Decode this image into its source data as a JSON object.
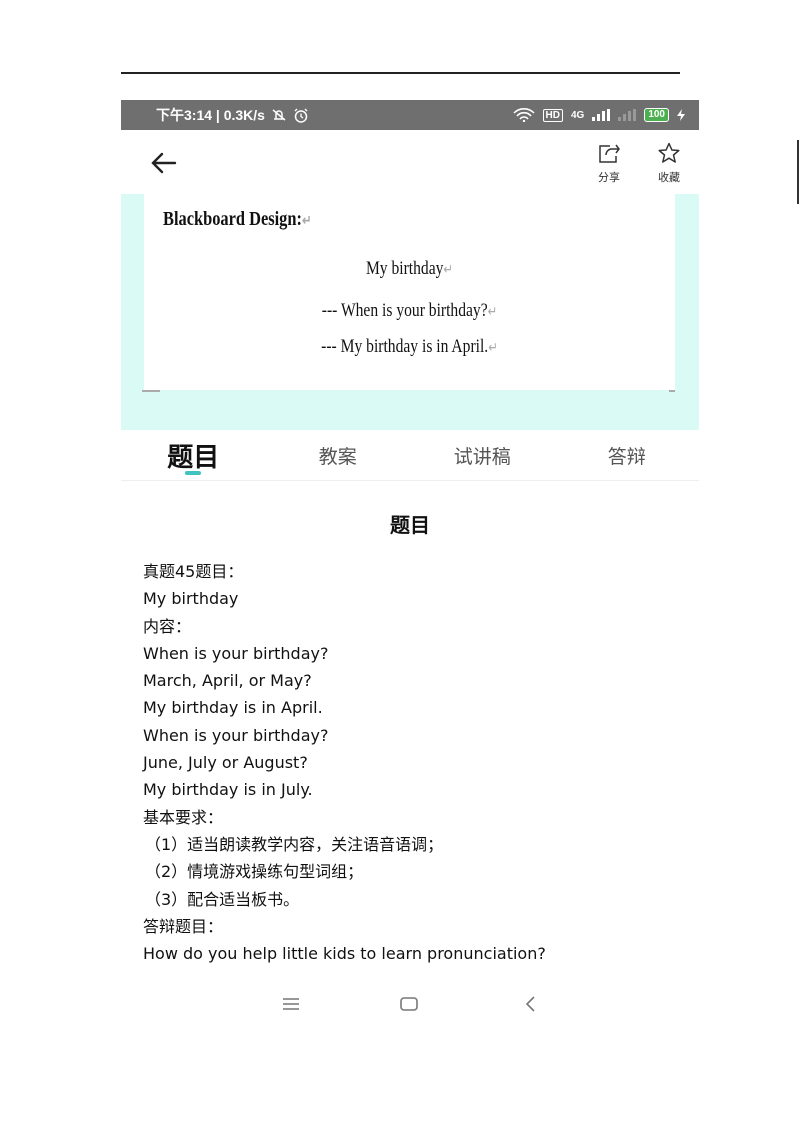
{
  "statusbar": {
    "time_network": "下午3:14 | 0.3K/s",
    "signal_4g": "4G",
    "hd": "HD",
    "battery": "100"
  },
  "appbar": {
    "share_label": "分享",
    "favorite_label": "收藏"
  },
  "blackboard": {
    "title": "Blackboard Design:",
    "lines": [
      "My birthday",
      "--- When is your birthday?",
      "--- My birthday is in April."
    ]
  },
  "tabs": [
    {
      "label": "题目",
      "active": true
    },
    {
      "label": "教案",
      "active": false
    },
    {
      "label": "试讲稿",
      "active": false
    },
    {
      "label": "答辩",
      "active": false
    }
  ],
  "content": {
    "heading": "题目",
    "lines": [
      "真题45题目：",
      "My birthday",
      "内容：",
      "When is your birthday?",
      "March, April, or May?",
      "My birthday is in April.",
      "When is your birthday?",
      "June, July or August?",
      "My birthday is in July.",
      "基本要求：",
      "（1）适当朗读教学内容，关注语音语调；",
      "（2）情境游戏操练句型词组；",
      "（3）配合适当板书。",
      "答辩题目：",
      "How do you help little kids to learn pronunciation?"
    ]
  },
  "colors": {
    "accent": "#3fc3c0",
    "board_bg": "#dafaf6",
    "statusbar_bg": "#6f6f6f"
  }
}
